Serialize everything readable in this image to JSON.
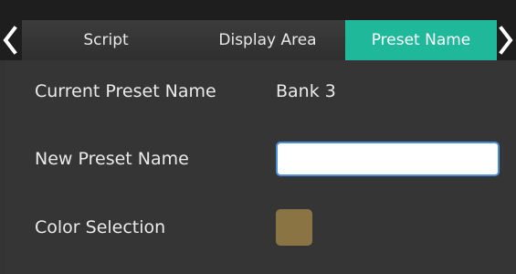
{
  "tabs": [
    {
      "label": "Script",
      "active": false
    },
    {
      "label": "Display Area",
      "active": false
    },
    {
      "label": "Preset Name",
      "active": true
    }
  ],
  "nav": {
    "prev_icon": "chevron-left-icon",
    "next_icon": "chevron-right-icon"
  },
  "current_preset": {
    "label": "Current Preset Name",
    "value": "Bank 3"
  },
  "new_preset": {
    "label": "New Preset Name",
    "value": ""
  },
  "color_selection": {
    "label": "Color Selection",
    "color": "#8b7444"
  },
  "colors": {
    "active_tab": "#1fb89b",
    "input_border": "#4a90d9"
  }
}
